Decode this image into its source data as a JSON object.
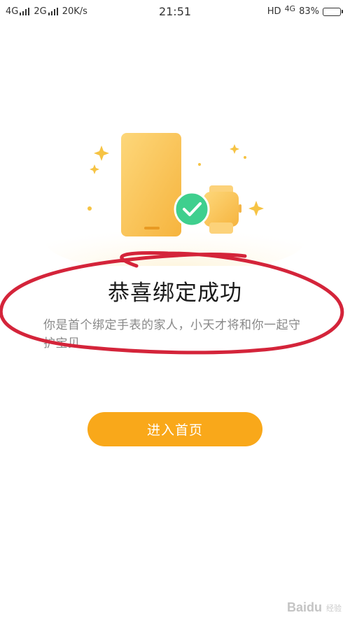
{
  "status_bar": {
    "sim1": "4G",
    "sim2": "2G",
    "speed": "20K/s",
    "time": "21:51",
    "hd": "HD",
    "network": "4G",
    "battery": "83%",
    "battery_level": 0.83
  },
  "illustration": {
    "icons": [
      "phone-icon",
      "watch-icon",
      "checkmark-icon",
      "sparkle-icon"
    ]
  },
  "content": {
    "title": "恭喜绑定成功",
    "subtitle": "你是首个绑定手表的家人，小天才将和你一起守护宝贝"
  },
  "actions": {
    "enter_label": "进入首页"
  },
  "watermark": {
    "text": "Baidu",
    "sub": "经验"
  },
  "colors": {
    "accent": "#f9a81a",
    "check_circle": "#3fcf8e",
    "annotation": "#d4243a"
  }
}
